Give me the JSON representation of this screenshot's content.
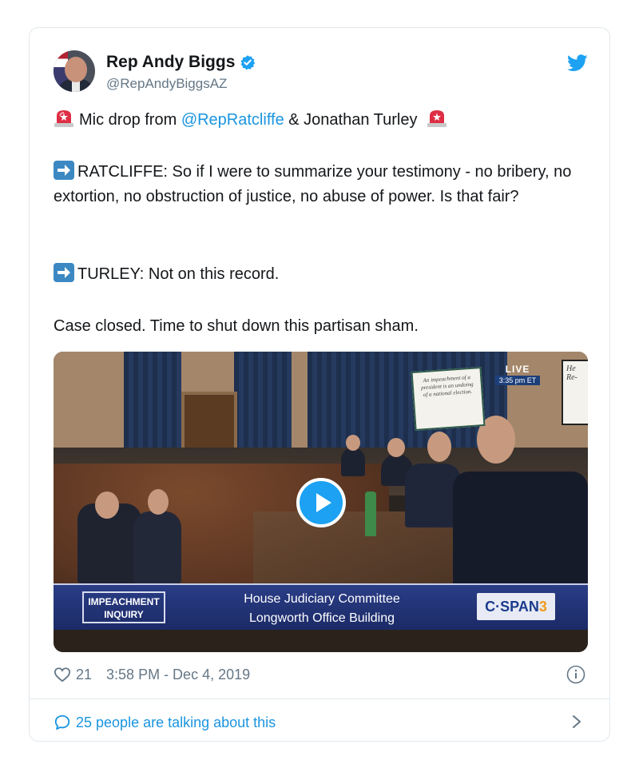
{
  "author": {
    "name": "Rep Andy Biggs",
    "handle": "@RepAndyBiggsAZ"
  },
  "icons": {
    "verified": "verified-badge-icon",
    "twitter": "twitter-bird-icon",
    "siren": "police-car-light-emoji",
    "arrow": "right-arrow-emoji",
    "heart": "heart-icon",
    "info": "info-icon",
    "comment": "speech-bubble-icon",
    "chevron": "chevron-right-icon",
    "play": "play-icon"
  },
  "tweet": {
    "line1_prefix": "Mic drop from",
    "line1_mention": "@RepRatcliffe",
    "line1_suffix": "& Jonathan Turley",
    "para2": "RATCLIFFE: So if I were to summarize your testimony - no bribery, no extortion, no obstruction of justice, no abuse of power. Is that fair?",
    "para3": "TURLEY: Not on this record.",
    "para4": "Case closed. Time to shut down this partisan sham."
  },
  "video": {
    "live_label": "LIVE",
    "live_time": "3:35 pm ET",
    "banner_left": [
      "IMPEACHMENT",
      "INQUIRY"
    ],
    "banner_line1": "House Judiciary Committee",
    "banner_line2": "Longworth Office Building",
    "network_prefix": "C·SPAN",
    "network_number": "3",
    "sign_text": "An impeachment of a president is an undoing of a national election.",
    "sign2_text": "He Re-"
  },
  "meta": {
    "likes": "21",
    "timestamp": "3:58 PM - Dec 4, 2019"
  },
  "footer": {
    "talking": "25 people are talking about this"
  },
  "colors": {
    "link": "#1b95e0",
    "twitter_blue": "#1da1f2",
    "muted": "#657786",
    "border": "#e1e8ed",
    "cspan_blue": "#1b2a66"
  }
}
